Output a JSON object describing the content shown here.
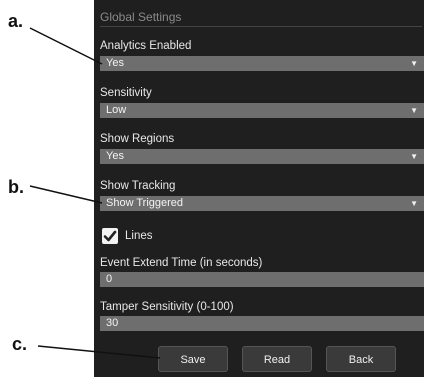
{
  "callouts": {
    "a": "a.",
    "b": "b.",
    "c": "c."
  },
  "panel": {
    "title": "Global Settings"
  },
  "analytics": {
    "label": "Analytics Enabled",
    "value": "Yes"
  },
  "sensitivity": {
    "label": "Sensitivity",
    "value": "Low"
  },
  "regions": {
    "label": "Show Regions",
    "value": "Yes"
  },
  "tracking": {
    "label": "Show Tracking",
    "value": "Show Triggered"
  },
  "lines": {
    "label": "Lines",
    "checked": true
  },
  "extend": {
    "label": "Event Extend Time (in seconds)",
    "value": "0"
  },
  "tamper": {
    "label": "Tamper Sensitivity (0-100)",
    "value": "30"
  },
  "buttons": {
    "save": "Save",
    "read": "Read",
    "back": "Back"
  },
  "icons": {
    "dropdown": "chevron-down-icon",
    "check": "checkmark-icon"
  }
}
